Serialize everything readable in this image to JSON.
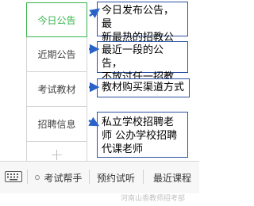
{
  "menu": {
    "items": [
      {
        "label": "今日公告",
        "active": true
      },
      {
        "label": "近期公告",
        "active": false
      },
      {
        "label": "考试教材",
        "active": false
      },
      {
        "label": "招聘信息",
        "active": false
      }
    ],
    "plus_label": "+"
  },
  "callouts": [
    "今日发布公告，最\n新最热的招教公告",
    "最近一段的公告，\n不放过任一招教",
    "教材购买渠道方式",
    "私立学校招聘老\n师 公办学校招聘\n代课老师"
  ],
  "tabbar": {
    "tabs": [
      "考试帮手",
      "预约试听",
      "最近课程"
    ]
  },
  "watermark": "河南山香教师招考部",
  "colors": {
    "active_green": "#35b34a",
    "callout_border": "#2c53a0",
    "arrow_blue": "#2a63c8"
  }
}
